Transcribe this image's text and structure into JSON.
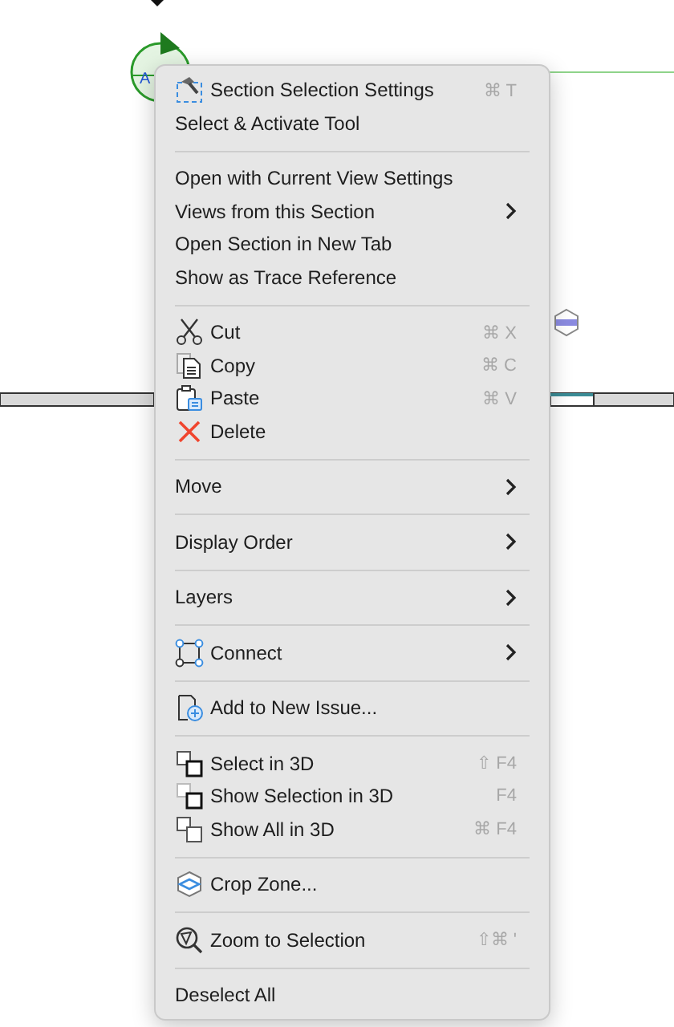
{
  "canvas": {
    "marker_label": "A"
  },
  "menu": {
    "groups": [
      {
        "items": [
          {
            "label": "Section Selection Settings",
            "icon": true,
            "shortcut": "⌘ T",
            "submenu": false
          },
          {
            "label": "Select & Activate Tool",
            "icon": false,
            "submenu": false
          }
        ]
      },
      {
        "items": [
          {
            "label": "Open with Current View Settings",
            "icon": false,
            "submenu": false
          },
          {
            "label": "Views from this Section",
            "icon": false,
            "submenu": true
          },
          {
            "label": "Open Section in New Tab",
            "icon": false,
            "submenu": false
          },
          {
            "label": "Show as Trace Reference",
            "icon": false,
            "submenu": false
          }
        ]
      },
      {
        "items": [
          {
            "label": "Cut",
            "icon": true,
            "shortcut": "⌘ X",
            "submenu": false
          },
          {
            "label": "Copy",
            "icon": true,
            "shortcut": "⌘ C",
            "submenu": false
          },
          {
            "label": "Paste",
            "icon": true,
            "shortcut": "⌘ V",
            "submenu": false
          },
          {
            "label": "Delete",
            "icon": true,
            "submenu": false
          }
        ]
      },
      {
        "items": [
          {
            "label": "Move",
            "icon": false,
            "submenu": true
          }
        ]
      },
      {
        "items": [
          {
            "label": "Display Order",
            "icon": false,
            "submenu": true
          }
        ]
      },
      {
        "items": [
          {
            "label": "Layers",
            "icon": false,
            "submenu": true
          }
        ]
      },
      {
        "items": [
          {
            "label": "Connect",
            "icon": true,
            "submenu": true
          }
        ]
      },
      {
        "items": [
          {
            "label": "Add to New Issue...",
            "icon": true,
            "submenu": false
          }
        ]
      },
      {
        "items": [
          {
            "label": "Select in 3D",
            "icon": true,
            "shortcut": "⇧ F4",
            "submenu": false
          },
          {
            "label": "Show Selection in 3D",
            "icon": true,
            "shortcut": "F4",
            "submenu": false
          },
          {
            "label": "Show All in 3D",
            "icon": true,
            "shortcut": "⌘ F4",
            "submenu": false
          }
        ]
      },
      {
        "items": [
          {
            "label": "Crop Zone...",
            "icon": true,
            "submenu": false
          }
        ]
      },
      {
        "items": [
          {
            "label": "Zoom to Selection",
            "icon": true,
            "shortcut": "⇧⌘ '",
            "submenu": false
          }
        ]
      },
      {
        "items": [
          {
            "label": "Deselect All",
            "icon": false,
            "submenu": false
          }
        ]
      }
    ]
  }
}
